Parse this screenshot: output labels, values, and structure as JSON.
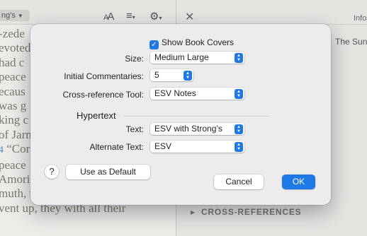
{
  "background": {
    "left_dropdown_label": "ng's",
    "toolbar_icons": [
      "font-size-icon",
      "list-icon",
      "gear-icon"
    ],
    "font_size_label_big": "A",
    "font_size_label_small": "A",
    "verse_lines": [
      "-zede",
      "evoted",
      "had c",
      "peace",
      "ecaus",
      "was g",
      "king c",
      "of Jarn"
    ],
    "verse_number": "4",
    "verse_lines_after": [
      "peace",
      "Amorite",
      "muth, the king of Lachish,",
      "vent up, they with all their"
    ],
    "verse_line_4_text": " “Cor",
    "info_label": "Info",
    "right_text": "The Sun",
    "cross_references_label": "CROSS-REFERENCES"
  },
  "dialog": {
    "show_book_covers_label": "Show Book Covers",
    "show_book_covers_checked": true,
    "size_label": "Size:",
    "size_value": "Medium Large",
    "initial_commentaries_label": "Initial Commentaries:",
    "initial_commentaries_value": "5",
    "cross_reference_tool_label": "Cross-reference Tool:",
    "cross_reference_tool_value": "ESV Notes",
    "hypertext_section_title": "Hypertext",
    "text_label": "Text:",
    "text_value": "ESV with Strong’s",
    "alternate_text_label": "Alternate Text:",
    "alternate_text_value": "ESV",
    "help_label": "?",
    "use_as_default_label": "Use as Default",
    "cancel_label": "Cancel",
    "ok_label": "OK",
    "accent_color": "#1d79e8"
  }
}
